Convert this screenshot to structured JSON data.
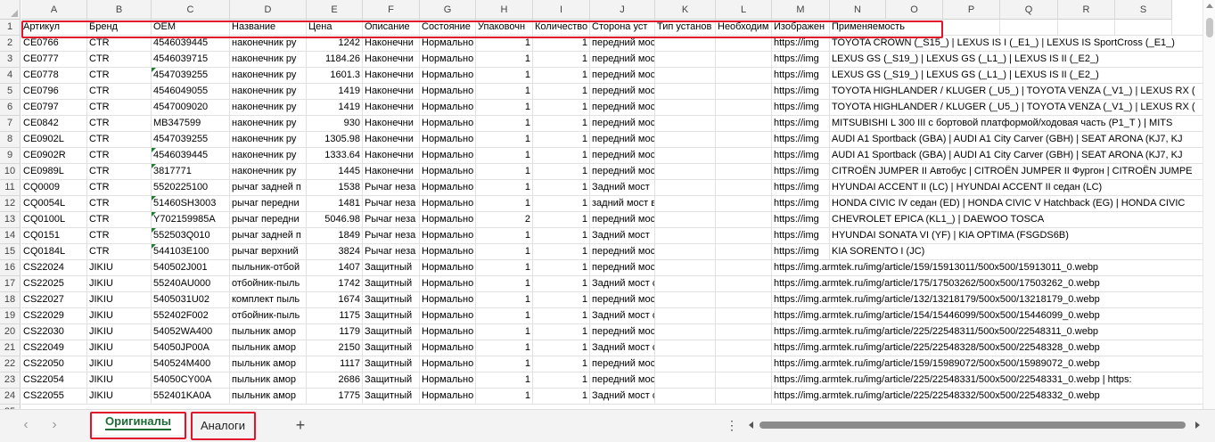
{
  "columns": [
    "A",
    "B",
    "C",
    "D",
    "E",
    "F",
    "G",
    "H",
    "I",
    "J",
    "K",
    "L",
    "M",
    "N",
    "O",
    "P",
    "Q",
    "R",
    "S"
  ],
  "row_numbers": [
    "1",
    "2",
    "3",
    "4",
    "5",
    "6",
    "7",
    "8",
    "9",
    "10",
    "11",
    "12",
    "13",
    "14",
    "15",
    "16",
    "17",
    "18",
    "19",
    "20",
    "21",
    "22",
    "23",
    "24",
    "25"
  ],
  "header": [
    "Артикул",
    "Бренд",
    "OEM",
    "Название",
    "Цена",
    "Описание",
    "Состояние",
    "Упаковочн",
    "Количество",
    "Сторона уст",
    "Тип установ",
    "Необходим",
    "Изображен",
    "Применяемость"
  ],
  "rows": [
    [
      "CE0766",
      "CTR",
      "4546039445",
      "наконечник ру",
      "1242",
      "Наконечни",
      "Нормально",
      "1",
      "1",
      "передний мост справа",
      "",
      "",
      "https://img",
      "TOYOTA CROWN (_S15_) | LEXUS IS I (_E1_) | LEXUS IS SportCross (_E1_)"
    ],
    [
      "CE0777",
      "CTR",
      "4546039715",
      "наконечник ру",
      "1184.26",
      "Наконечни",
      "Нормально",
      "1",
      "1",
      "передний мост справа",
      "",
      "",
      "https://img",
      "LEXUS GS (_S19_) | LEXUS GS (_L1_) | LEXUS IS II (_E2_)"
    ],
    [
      "CE0778",
      "CTR",
      "4547039255",
      "наконечник ру",
      "1601.3",
      "Наконечни",
      "Нормально",
      "1",
      "1",
      "передний мост слева",
      "",
      "",
      "https://img",
      "LEXUS GS (_S19_) | LEXUS GS (_L1_) | LEXUS IS II (_E2_)"
    ],
    [
      "CE0796",
      "CTR",
      "4546049055",
      "наконечник ру",
      "1419",
      "Наконечни",
      "Нормально",
      "1",
      "1",
      "передний мост справа",
      "",
      "",
      "https://img",
      "TOYOTA HIGHLANDER / KLUGER (_U5_) | TOYOTA VENZA (_V1_) | LEXUS RX ("
    ],
    [
      "CE0797",
      "CTR",
      "4547009020",
      "наконечник ру",
      "1419",
      "Наконечни",
      "Нормально",
      "1",
      "1",
      "передний мост слева",
      "",
      "",
      "https://img",
      "TOYOTA HIGHLANDER / KLUGER (_U5_) | TOYOTA VENZA (_V1_) | LEXUS RX ("
    ],
    [
      "CE0842",
      "CTR",
      "MB347599",
      "наконечник ру",
      "930",
      "Наконечни",
      "Нормально",
      "1",
      "1",
      "передний мост",
      "",
      "",
      "https://img",
      "MITSUBISHI L 300 III с бортовой платформой/ходовая часть (P1_T ) | MITS"
    ],
    [
      "CE0902L",
      "CTR",
      "4547039255",
      "наконечник ру",
      "1305.98",
      "Наконечни",
      "Нормально",
      "1",
      "1",
      "передний мост слева",
      "",
      "",
      "https://img",
      "AUDI A1 Sportback (GBA) | AUDI A1 City Carver (GBH) | SEAT ARONA (KJ7, KJ"
    ],
    [
      "CE0902R",
      "CTR",
      "4546039445",
      "наконечник ру",
      "1333.64",
      "Наконечни",
      "Нормально",
      "1",
      "1",
      "передний мост справа",
      "",
      "",
      "https://img",
      "AUDI A1 Sportback (GBA) | AUDI A1 City Carver (GBH) | SEAT ARONA (KJ7, KJ"
    ],
    [
      "CE0989L",
      "CTR",
      "3817771",
      "наконечник ру",
      "1445",
      "Наконечни",
      "Нормально",
      "1",
      "1",
      "передний мост слева",
      "",
      "",
      "https://img",
      "CITROËN JUMPER II Автобус | CITROËN JUMPER II Фургон | CITROËN JUMPE"
    ],
    [
      "CQ0009",
      "CTR",
      "5520225100",
      "рычаг задней п",
      "1538",
      "Рычаг неза",
      "Нормально",
      "1",
      "1",
      "Задний мост",
      "",
      "",
      "https://img",
      "HYUNDAI ACCENT II (LC) | HYUNDAI ACCENT II седан (LC)"
    ],
    [
      "CQ0054L",
      "CTR",
      "51460SH3003",
      "рычаг передни",
      "1481",
      "Рычаг неза",
      "Нормально",
      "1",
      "1",
      "задний мост верхний",
      "",
      "",
      "https://img",
      "HONDA CIVIC IV седан (ED) | HONDA CIVIC V Hatchback (EG) | HONDA CIVIC"
    ],
    [
      "CQ0100L",
      "CTR",
      "Y702159985A",
      "рычаг передни",
      "5046.98",
      "Рычаг неза",
      "Нормально",
      "2",
      "1",
      "передний мост",
      "",
      "",
      "https://img",
      "CHEVROLET EPICA (KL1_) | DAEWOO TOSCA"
    ],
    [
      "CQ0151",
      "CTR",
      "552503Q010",
      "рычаг задней п",
      "1849",
      "Рычаг неза",
      "Нормально",
      "1",
      "1",
      "Задний мост",
      "",
      "",
      "https://img",
      "HYUNDAI SONATA VI (YF) | KIA OPTIMA (FSGDS6B)"
    ],
    [
      "CQ0184L",
      "CTR",
      "544103E100",
      "рычаг верхний",
      "3824",
      "Рычаг неза",
      "Нормально",
      "1",
      "1",
      "передний мост слева",
      "",
      "",
      "https://img",
      "KIA SORENTO I (JC)"
    ],
    [
      "CS22024",
      "JIKIU",
      "540502J001",
      "пыльник-отбой",
      "1407",
      "Защитный",
      "Нормально",
      "1",
      "1",
      "передний мост слева",
      "",
      "",
      "https://img.armtek.ru/img/article/159/15913011/500x500/15913011_0.webp",
      ""
    ],
    [
      "CS22025",
      "JIKIU",
      "55240AU000",
      "отбойник-пыль",
      "1742",
      "Защитный",
      "Нормально",
      "1",
      "1",
      "Задний мост слева",
      "",
      "",
      "https://img.armtek.ru/img/article/175/17503262/500x500/17503262_0.webp",
      ""
    ],
    [
      "CS22027",
      "JIKIU",
      "5405031U02",
      "комплект пыль",
      "1674",
      "Защитный",
      "Нормально",
      "1",
      "1",
      "передний мост",
      "",
      "",
      "https://img.armtek.ru/img/article/132/13218179/500x500/13218179_0.webp",
      ""
    ],
    [
      "CS22029",
      "JIKIU",
      "552402F002",
      "отбойник-пыль",
      "1175",
      "Защитный",
      "Нормально",
      "1",
      "1",
      "Задний мост слева",
      "",
      "",
      "https://img.armtek.ru/img/article/154/15446099/500x500/15446099_0.webp",
      ""
    ],
    [
      "CS22030",
      "JIKIU",
      "54052WA400",
      "пыльник амор",
      "1179",
      "Защитный",
      "Нормально",
      "1",
      "1",
      "передний мост слева",
      "",
      "",
      "https://img.armtek.ru/img/article/225/22548311/500x500/22548311_0.webp",
      ""
    ],
    [
      "CS22049",
      "JIKIU",
      "54050JP00A",
      "пыльник амор",
      "2150",
      "Защитный",
      "Нормально",
      "1",
      "1",
      "Задний мост слева",
      "",
      "",
      "https://img.armtek.ru/img/article/225/22548328/500x500/22548328_0.webp",
      ""
    ],
    [
      "CS22050",
      "JIKIU",
      "540524M400",
      "пыльник амор",
      "1117",
      "Защитный",
      "Нормально",
      "1",
      "1",
      "передний мост слева",
      "",
      "",
      "https://img.armtek.ru/img/article/159/15989072/500x500/15989072_0.webp",
      ""
    ],
    [
      "CS22054",
      "JIKIU",
      "54050CY00A",
      "пыльник амор",
      "2686",
      "Защитный",
      "Нормально",
      "1",
      "1",
      "передний мост слева",
      "",
      "",
      "https://img.armtek.ru/img/article/225/22548331/500x500/22548331_0.webp | https:",
      ""
    ],
    [
      "CS22055",
      "JIKIU",
      "552401KA0A",
      "пыльник амор",
      "1775",
      "Защитный",
      "Нормально",
      "1",
      "1",
      "Задний мост слева",
      "",
      "",
      "https://img.armtek.ru/img/article/225/22548332/500x500/22548332_0.webp",
      ""
    ]
  ],
  "sheet_tabs": [
    {
      "label": "Оригиналы",
      "active": true
    },
    {
      "label": "Аналоги",
      "active": false
    }
  ],
  "add_sheet_label": "+",
  "more_label": "⋮",
  "nav_prev": "‹",
  "nav_next": "›",
  "colors": {
    "highlight": "#e0142a",
    "active_tab": "#1e6b35",
    "error_marker": "#1e7b34"
  }
}
